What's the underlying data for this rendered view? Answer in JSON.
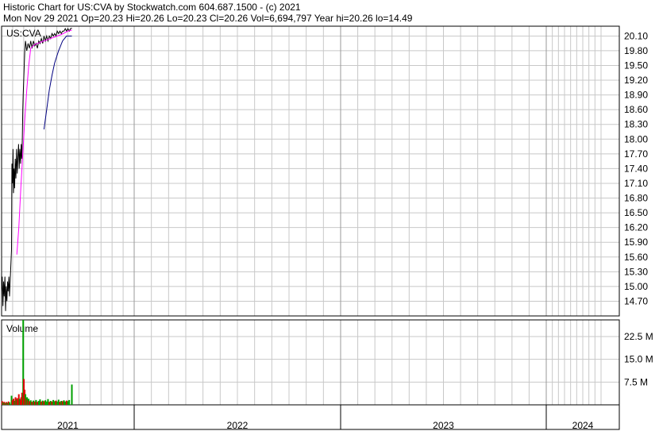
{
  "header": {
    "line1": "Historic Chart for US:CVA by Stockwatch.com 604.687.1500 - (c) 2021",
    "line2": "Mon Nov 29 2021   Op=20.23   Hi=20.26   Lo=20.23   Cl=20.26   Vol=6,694,797   Year hi=20.26   lo=14.49"
  },
  "price_panel": {
    "symbol_label": "US:CVA",
    "price_ticks": [
      "20.10",
      "19.80",
      "19.50",
      "19.20",
      "18.90",
      "18.60",
      "18.30",
      "18.00",
      "17.70",
      "17.40",
      "17.10",
      "16.80",
      "16.50",
      "16.20",
      "15.90",
      "15.60",
      "15.30",
      "15.00",
      "14.70"
    ]
  },
  "volume_panel": {
    "label": "Volume",
    "volume_ticks": [
      "22.5 M",
      "15.0 M",
      "7.5 M"
    ]
  },
  "x_axis": {
    "years": [
      "2021",
      "2022",
      "2023",
      "2024"
    ]
  },
  "colors": {
    "price_line": "#000000",
    "ma_fast": "#ff00ff",
    "ma_slow": "#000080",
    "volume_up": "#00a000",
    "volume_down": "#e00000",
    "grid": "#c8c8c8"
  },
  "chart_data": {
    "type": "line",
    "title": "Historic Chart for US:CVA",
    "ylim": [
      14.4,
      20.3
    ],
    "volume_ylim": [
      0,
      28
    ],
    "x_range_years": [
      2021.0,
      2024.75
    ],
    "series": [
      {
        "kind": "price",
        "points": [
          [
            2021.0,
            14.9
          ],
          [
            2021.005,
            15.2
          ],
          [
            2021.01,
            14.6
          ],
          [
            2021.015,
            15.1
          ],
          [
            2021.02,
            14.8
          ],
          [
            2021.025,
            15.2
          ],
          [
            2021.03,
            14.5
          ],
          [
            2021.035,
            15.0
          ],
          [
            2021.04,
            14.7
          ],
          [
            2021.045,
            15.1
          ],
          [
            2021.05,
            14.9
          ],
          [
            2021.055,
            15.2
          ],
          [
            2021.06,
            14.8
          ],
          [
            2021.075,
            15.75
          ],
          [
            2021.078,
            17.5
          ],
          [
            2021.082,
            17.1
          ],
          [
            2021.086,
            17.8
          ],
          [
            2021.09,
            16.9
          ],
          [
            2021.094,
            17.4
          ],
          [
            2021.098,
            17.0
          ],
          [
            2021.103,
            17.6
          ],
          [
            2021.108,
            17.2
          ],
          [
            2021.113,
            17.8
          ],
          [
            2021.118,
            17.3
          ],
          [
            2021.123,
            17.6
          ],
          [
            2021.128,
            17.9
          ],
          [
            2021.133,
            17.4
          ],
          [
            2021.138,
            17.8
          ],
          [
            2021.143,
            17.5
          ],
          [
            2021.148,
            17.9
          ],
          [
            2021.152,
            17.6
          ],
          [
            2021.156,
            18.0
          ],
          [
            2021.16,
            18.6
          ],
          [
            2021.163,
            18.9
          ],
          [
            2021.175,
            19.8
          ],
          [
            2021.18,
            20.0
          ],
          [
            2021.19,
            19.8
          ],
          [
            2021.2,
            19.95
          ],
          [
            2021.21,
            19.85
          ],
          [
            2021.22,
            20.0
          ],
          [
            2021.23,
            19.85
          ],
          [
            2021.24,
            20.0
          ],
          [
            2021.25,
            19.9
          ],
          [
            2021.26,
            19.95
          ],
          [
            2021.27,
            19.85
          ],
          [
            2021.28,
            20.0
          ],
          [
            2021.29,
            19.95
          ],
          [
            2021.3,
            20.05
          ],
          [
            2021.31,
            19.95
          ],
          [
            2021.32,
            20.1
          ],
          [
            2021.33,
            20.0
          ],
          [
            2021.34,
            20.1
          ],
          [
            2021.35,
            20.0
          ],
          [
            2021.36,
            20.1
          ],
          [
            2021.37,
            20.05
          ],
          [
            2021.38,
            20.15
          ],
          [
            2021.39,
            20.1
          ],
          [
            2021.4,
            20.15
          ],
          [
            2021.41,
            20.1
          ],
          [
            2021.42,
            20.2
          ],
          [
            2021.43,
            20.15
          ],
          [
            2021.44,
            20.2
          ],
          [
            2021.45,
            20.15
          ],
          [
            2021.46,
            20.2
          ],
          [
            2021.47,
            20.2
          ],
          [
            2021.48,
            20.25
          ],
          [
            2021.49,
            20.2
          ],
          [
            2021.5,
            20.25
          ],
          [
            2021.51,
            20.2
          ],
          [
            2021.52,
            20.25
          ],
          [
            2021.53,
            20.26
          ]
        ]
      },
      {
        "kind": "ma_fast",
        "points": [
          [
            2021.115,
            15.65
          ],
          [
            2021.13,
            16.2
          ],
          [
            2021.145,
            17.0
          ],
          [
            2021.16,
            17.7
          ],
          [
            2021.175,
            18.4
          ],
          [
            2021.19,
            19.0
          ],
          [
            2021.205,
            19.5
          ],
          [
            2021.22,
            19.85
          ],
          [
            2021.25,
            19.93
          ],
          [
            2021.3,
            19.98
          ],
          [
            2021.35,
            20.03
          ],
          [
            2021.4,
            20.08
          ],
          [
            2021.45,
            20.13
          ],
          [
            2021.5,
            20.2
          ],
          [
            2021.53,
            20.22
          ]
        ]
      },
      {
        "kind": "ma_slow",
        "points": [
          [
            2021.32,
            18.2
          ],
          [
            2021.34,
            18.6
          ],
          [
            2021.36,
            19.0
          ],
          [
            2021.38,
            19.3
          ],
          [
            2021.4,
            19.55
          ],
          [
            2021.43,
            19.8
          ],
          [
            2021.46,
            20.0
          ],
          [
            2021.49,
            20.1
          ],
          [
            2021.53,
            20.1
          ]
        ]
      }
    ],
    "volume": [
      [
        2021.005,
        1.2,
        "down"
      ],
      [
        2021.012,
        0.8,
        "up"
      ],
      [
        2021.02,
        1.0,
        "down"
      ],
      [
        2021.028,
        0.6,
        "up"
      ],
      [
        2021.036,
        0.9,
        "down"
      ],
      [
        2021.044,
        0.7,
        "up"
      ],
      [
        2021.052,
        1.1,
        "down"
      ],
      [
        2021.06,
        0.8,
        "up"
      ],
      [
        2021.075,
        3.0,
        "up"
      ],
      [
        2021.082,
        1.5,
        "down"
      ],
      [
        2021.09,
        2.0,
        "down"
      ],
      [
        2021.098,
        1.3,
        "up"
      ],
      [
        2021.105,
        2.5,
        "down"
      ],
      [
        2021.112,
        1.8,
        "up"
      ],
      [
        2021.118,
        2.2,
        "down"
      ],
      [
        2021.124,
        1.6,
        "down"
      ],
      [
        2021.13,
        3.5,
        "down"
      ],
      [
        2021.136,
        2.0,
        "up"
      ],
      [
        2021.142,
        1.5,
        "down"
      ],
      [
        2021.148,
        2.5,
        "down"
      ],
      [
        2021.154,
        4.0,
        "down"
      ],
      [
        2021.163,
        28.0,
        "up"
      ],
      [
        2021.168,
        8.5,
        "down"
      ],
      [
        2021.174,
        5.0,
        "down"
      ],
      [
        2021.18,
        3.5,
        "up"
      ],
      [
        2021.186,
        2.0,
        "down"
      ],
      [
        2021.192,
        2.5,
        "up"
      ],
      [
        2021.198,
        1.5,
        "down"
      ],
      [
        2021.204,
        2.0,
        "up"
      ],
      [
        2021.21,
        1.2,
        "down"
      ],
      [
        2021.22,
        1.5,
        "up"
      ],
      [
        2021.23,
        1.0,
        "down"
      ],
      [
        2021.24,
        1.4,
        "up"
      ],
      [
        2021.25,
        1.1,
        "down"
      ],
      [
        2021.26,
        1.6,
        "up"
      ],
      [
        2021.27,
        1.0,
        "down"
      ],
      [
        2021.28,
        1.3,
        "up"
      ],
      [
        2021.29,
        1.8,
        "up"
      ],
      [
        2021.3,
        1.1,
        "down"
      ],
      [
        2021.31,
        1.4,
        "up"
      ],
      [
        2021.32,
        1.2,
        "down"
      ],
      [
        2021.33,
        1.5,
        "up"
      ],
      [
        2021.34,
        1.1,
        "up"
      ],
      [
        2021.35,
        1.9,
        "up"
      ],
      [
        2021.36,
        1.0,
        "down"
      ],
      [
        2021.37,
        1.3,
        "up"
      ],
      [
        2021.38,
        1.1,
        "down"
      ],
      [
        2021.39,
        1.6,
        "up"
      ],
      [
        2021.4,
        1.2,
        "up"
      ],
      [
        2021.41,
        1.4,
        "down"
      ],
      [
        2021.42,
        1.1,
        "up"
      ],
      [
        2021.43,
        1.7,
        "up"
      ],
      [
        2021.44,
        1.0,
        "down"
      ],
      [
        2021.45,
        1.3,
        "up"
      ],
      [
        2021.46,
        1.2,
        "down"
      ],
      [
        2021.47,
        1.5,
        "up"
      ],
      [
        2021.48,
        1.1,
        "up"
      ],
      [
        2021.49,
        1.4,
        "down"
      ],
      [
        2021.5,
        1.2,
        "up"
      ],
      [
        2021.51,
        1.6,
        "up"
      ],
      [
        2021.53,
        6.69,
        "up"
      ]
    ]
  }
}
